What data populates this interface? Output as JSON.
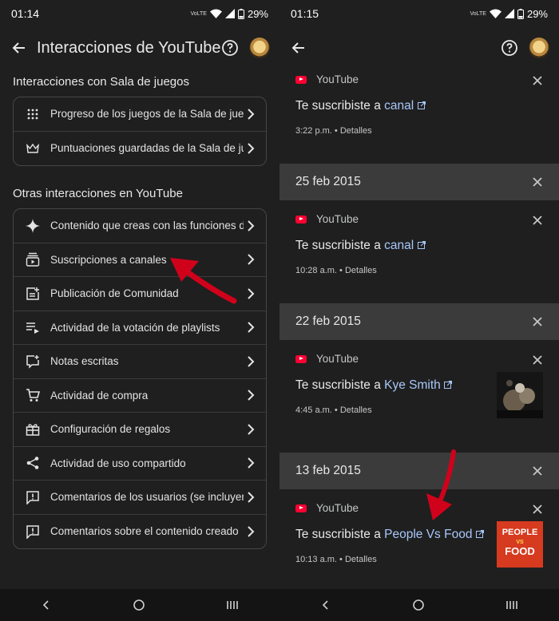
{
  "left": {
    "status": {
      "time": "01:14",
      "volte": "VoLTE",
      "battery": "29%"
    },
    "appbar": {
      "title": "Interacciones de YouTube"
    },
    "section1": {
      "title": "Interacciones con Sala de juegos",
      "items": [
        {
          "label": "Progreso de los juegos de la Sala de juegos",
          "icon": "dots-grid-icon"
        },
        {
          "label": "Puntuaciones guardadas de la Sala de juegos",
          "icon": "crown-icon"
        }
      ]
    },
    "section2": {
      "title": "Otras interacciones en YouTube",
      "items": [
        {
          "label": "Contenido que creas con las funciones de IA",
          "icon": "sparkle-icon"
        },
        {
          "label": "Suscripciones a canales",
          "icon": "subscriptions-icon"
        },
        {
          "label": "Publicación de Comunidad",
          "icon": "post-icon"
        },
        {
          "label": "Actividad de la votación de playlists",
          "icon": "playlist-icon"
        },
        {
          "label": "Notas escritas",
          "icon": "note-icon"
        },
        {
          "label": "Actividad de compra",
          "icon": "cart-icon"
        },
        {
          "label": "Configuración de regalos",
          "icon": "gift-icon"
        },
        {
          "label": "Actividad de uso compartido",
          "icon": "share-icon"
        },
        {
          "label": "Comentarios de los usuarios (se incluyen comentarios)",
          "icon": "feedback-icon"
        },
        {
          "label": "Comentarios sobre el contenido creado",
          "icon": "feedback-icon"
        }
      ]
    }
  },
  "right": {
    "status": {
      "time": "01:15",
      "volte": "VoLTE",
      "battery": "29%"
    },
    "entries": [
      {
        "source": "YouTube",
        "prefix": "Te suscribiste a ",
        "channel": "canal",
        "time": "3:22 p.m.",
        "details": "Detalles"
      },
      {
        "date": "25 feb 2015",
        "source": "YouTube",
        "prefix": "Te suscribiste a ",
        "channel": "canal",
        "time": "10:28 a.m.",
        "details": "Detalles"
      },
      {
        "date": "22 feb 2015",
        "source": "YouTube",
        "prefix": "Te suscribiste a ",
        "channel": "Kye Smith",
        "time": "4:45 a.m.",
        "details": "Detalles"
      },
      {
        "date": "13 feb 2015",
        "source": "YouTube",
        "prefix": "Te suscribiste a ",
        "channel": "People Vs Food",
        "time": "10:13 a.m.",
        "details": "Detalles",
        "thumb_text": [
          "PEOPLE",
          "VS",
          "FOOD"
        ]
      }
    ]
  },
  "colors": {
    "background": "#1f1f1f",
    "link": "#a8c7fa",
    "annotation_arrow": "#d0021b",
    "youtube_red": "#ff0033"
  }
}
